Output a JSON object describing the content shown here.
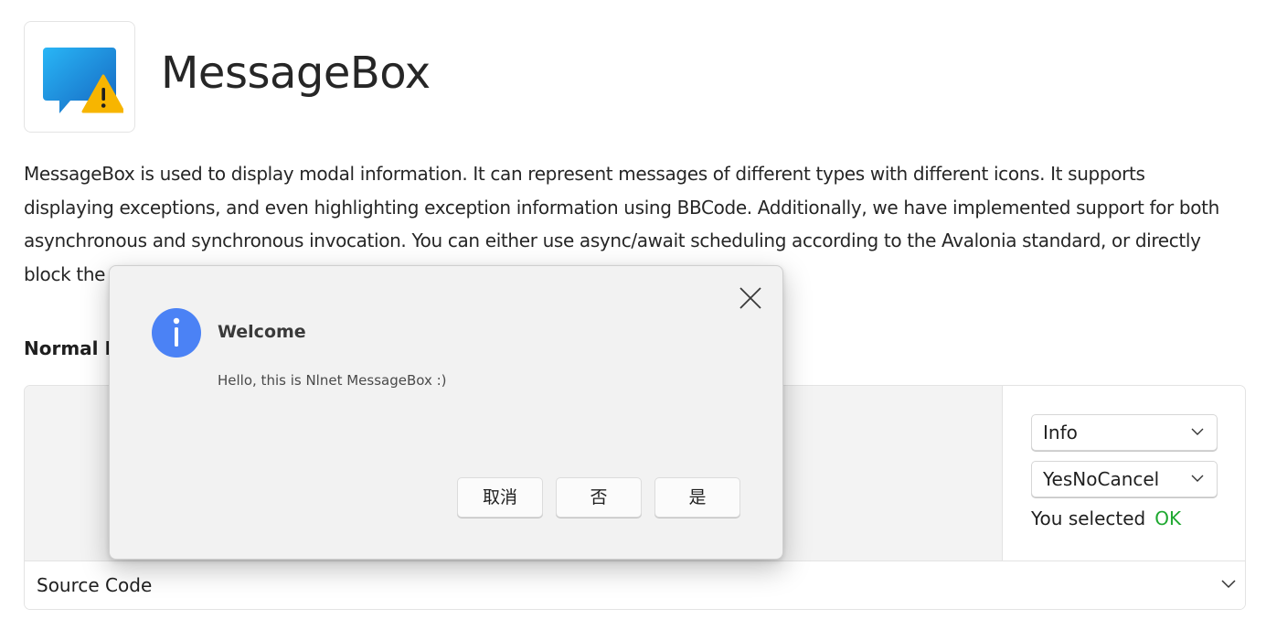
{
  "header": {
    "title": "MessageBox",
    "icon": "message-warning-icon"
  },
  "description": "MessageBox is used to display modal information. It can represent messages of different types with different icons. It supports displaying exceptions, and even highlighting exception information using BBCode. Additionally, we have implemented support for both asynchronous and synchronous invocation. You can either use async/await scheduling according to the Avalonia standard, or directly block the UI for the return of the Show function following the WPF standard.",
  "section": {
    "title": "Normal MessageBox"
  },
  "options": {
    "icon_combo": {
      "selected": "Info"
    },
    "buttons_combo": {
      "selected": "YesNoCancel"
    },
    "result_label": "You selected",
    "result_value": "OK"
  },
  "source": {
    "label": "Source Code"
  },
  "dialog": {
    "icon": "info-icon",
    "title": "Welcome",
    "message": "Hello, this is Nlnet MessageBox :)",
    "buttons": {
      "cancel": "取消",
      "no": "否",
      "yes": "是"
    }
  },
  "colors": {
    "accent_blue": "#4b82f5",
    "result_green": "#1ea830",
    "warning_yellow": "#f7b500"
  }
}
